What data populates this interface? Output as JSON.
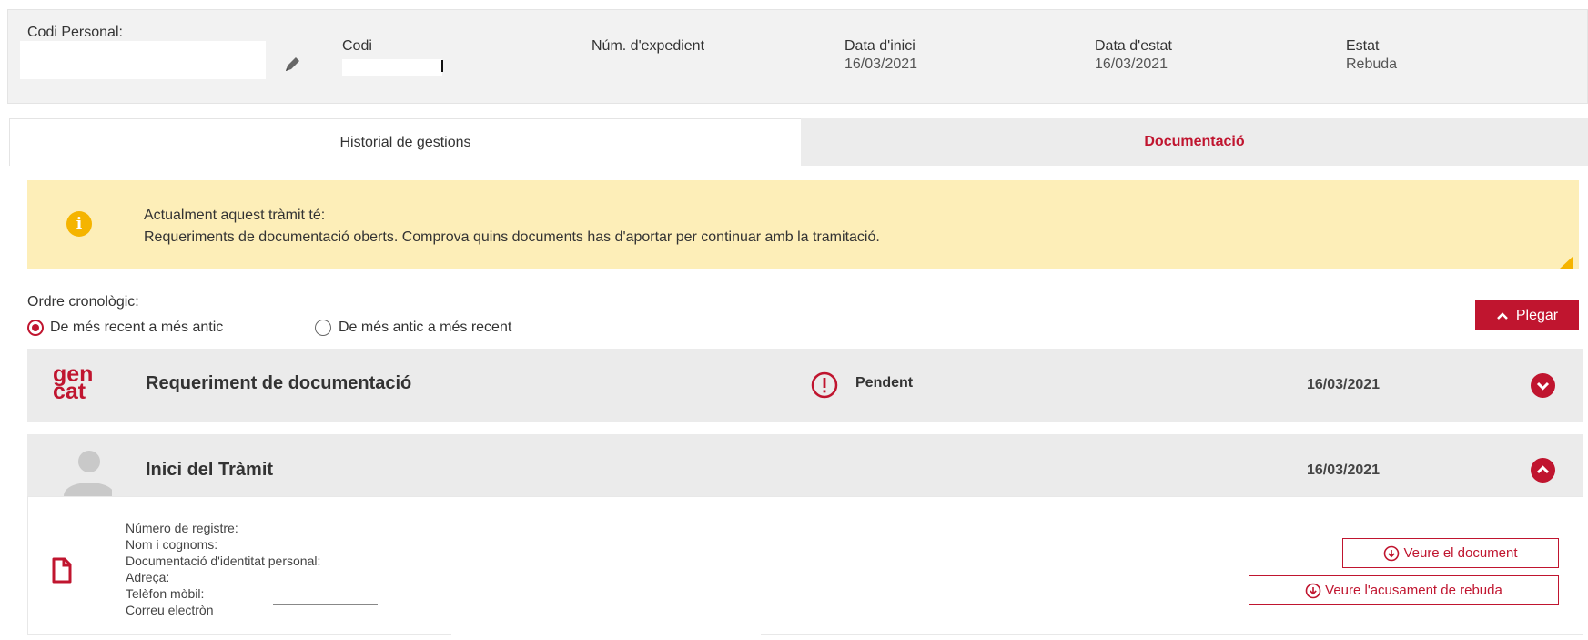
{
  "header": {
    "codi_personal_label": "Codi Personal:",
    "codi_label": "Codi",
    "num_expedient_label": "Núm. d'expedient",
    "data_inici_label": "Data d'inici",
    "data_inici_value": "16/03/2021",
    "data_estat_label": "Data d'estat",
    "data_estat_value": "16/03/2021",
    "estat_label": "Estat",
    "estat_value": "Rebuda"
  },
  "tabs": [
    {
      "label": "Historial de gestions",
      "active": true
    },
    {
      "label": "Documentació",
      "active": false
    }
  ],
  "alert": {
    "line1": "Actualment aquest tràmit té:",
    "line2": "Requeriments de documentació oberts. Comprova quins documents has d'aportar per continuar amb la tramitació.",
    "icon": "info-icon"
  },
  "order": {
    "label": "Ordre cronològic:",
    "options": [
      {
        "label": "De més recent a més antic",
        "selected": true
      },
      {
        "label": "De més antic a més recent",
        "selected": false
      }
    ]
  },
  "collapse_button": {
    "label": "Plegar",
    "icon": "chevron-up-icon"
  },
  "timeline": [
    {
      "logo_line1": "gen",
      "logo_line2": "cat",
      "title": "Requeriment de documentació",
      "status": "Pendent",
      "status_icon": "alert-circle-icon",
      "date": "16/03/2021",
      "expanded": false
    },
    {
      "title": "Inici del Tràmit",
      "date": "16/03/2021",
      "expanded": true,
      "details": [
        "Número de registre:",
        "Nom i cognoms:",
        "Documentació d'identitat personal:",
        "Adreça:",
        "Telèfon mòbil:",
        "Correu electròn"
      ],
      "actions": [
        "Veure el document",
        "Veure l'acusament de rebuda"
      ]
    }
  ],
  "colors": {
    "accent": "#c0152f",
    "alert_bg": "#fdeeb8",
    "alert_icon": "#f5b400",
    "row_bg": "#ebebeb"
  }
}
